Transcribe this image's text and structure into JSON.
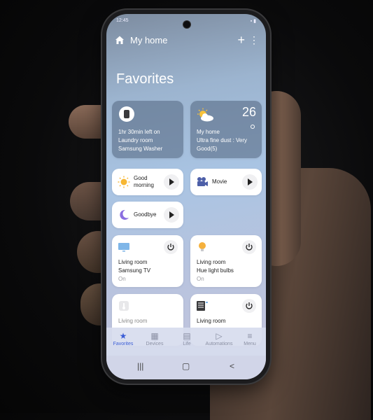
{
  "status": {
    "time": "12:45",
    "icons": "▪ ▮"
  },
  "header": {
    "title": "My home",
    "add": "+",
    "more": "⋮"
  },
  "section_title": "Favorites",
  "washer_card": {
    "icon": "washer-icon",
    "line1": "1hr 30min left on",
    "line2": "Laundry room",
    "line3": "Samsung Washer"
  },
  "weather_card": {
    "icon": "partly-sunny-icon",
    "temperature": "26",
    "line1": "My home",
    "line2": "Ultra fine dust : Very",
    "line3": "Good(5)"
  },
  "scenes": [
    {
      "icon": "sun-icon",
      "label_line1": "Good",
      "label_line2": "morning"
    },
    {
      "icon": "movie-camera-icon",
      "label_line1": "Movie",
      "label_line2": ""
    },
    {
      "icon": "moon-icon",
      "label_line1": "Goodbye",
      "label_line2": ""
    }
  ],
  "devices": [
    {
      "icon": "tv-icon",
      "room": "Living room",
      "name": "Samsung TV",
      "state": "On"
    },
    {
      "icon": "bulb-icon",
      "room": "Living room",
      "name": "Hue light bulbs",
      "state": "On"
    },
    {
      "icon": "thermometer-icon",
      "room": "Living room",
      "name": "",
      "state": ""
    },
    {
      "icon": "air-purifier-icon",
      "room": "Living room",
      "name": "",
      "state": ""
    }
  ],
  "bottom_nav": [
    {
      "label": "Favorites",
      "glyph": "★",
      "active": true
    },
    {
      "label": "Devices",
      "glyph": "▦",
      "active": false
    },
    {
      "label": "Life",
      "glyph": "▤",
      "active": false
    },
    {
      "label": "Automations",
      "glyph": "▷",
      "active": false
    },
    {
      "label": "Menu",
      "glyph": "≡",
      "active": false
    }
  ],
  "system_nav": {
    "recents": "|||",
    "home": "▢",
    "back": "<"
  },
  "colors": {
    "accent": "#3b5dd6",
    "card": "#ffffff",
    "screen_bg": "#a9c4e3"
  }
}
